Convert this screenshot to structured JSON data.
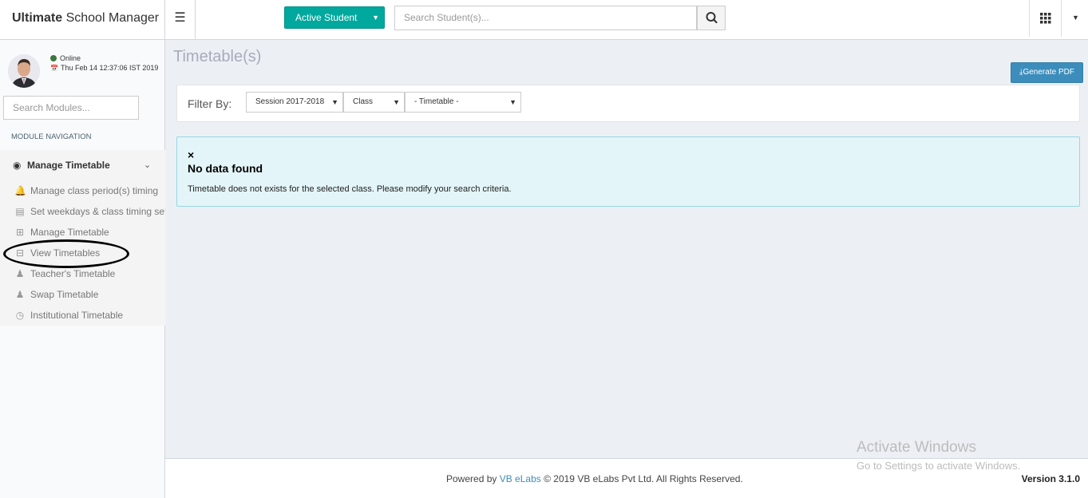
{
  "header": {
    "brand_bold": "Ultimate",
    "brand_rest": "School Manager",
    "active_button": "Active Student",
    "search_placeholder": "Search Student(s)..."
  },
  "sidebar": {
    "status": "Online",
    "datetime": "Thu Feb 14 12:37:06 IST 2019",
    "search_placeholder": "Search Modules...",
    "nav_header": "MODULE NAVIGATION",
    "module_title": "Manage Timetable",
    "items": [
      {
        "label": "Manage class period(s) timing",
        "icon": "bell-icon"
      },
      {
        "label": "Set weekdays & class timing sets",
        "icon": "calendar-icon"
      },
      {
        "label": "Manage Timetable",
        "icon": "calendar-plus-icon"
      },
      {
        "label": "View Timetables",
        "icon": "calendar-minus-icon"
      },
      {
        "label": "Teacher's Timetable",
        "icon": "user-icon"
      },
      {
        "label": "Swap Timetable",
        "icon": "user-icon"
      },
      {
        "label": "Institutional Timetable",
        "icon": "clock-icon"
      }
    ]
  },
  "main": {
    "page_title": "Timetable(s)",
    "generate_pdf": "Generate PDF",
    "filter_label": "Filter By:",
    "filters": {
      "session": "Session 2017-2018",
      "class": "Class",
      "timetable": "- Timetable -"
    },
    "alert": {
      "close": "×",
      "title": "No data found",
      "message": "Timetable does not exists for the selected class. Please modify your search criteria."
    }
  },
  "footer": {
    "powered_by": "Powered by",
    "company_link": "VB eLabs",
    "copyright": "© 2019 VB eLabs Pvt Ltd. All Rights Reserved.",
    "version": "Version 3.1.0"
  },
  "watermark": {
    "line1": "Activate Windows",
    "line2": "Go to Settings to activate Windows."
  },
  "colors": {
    "accent_teal": "#00a89d",
    "primary_blue": "#3c8dbc",
    "alert_bg": "#e3f5f8"
  }
}
